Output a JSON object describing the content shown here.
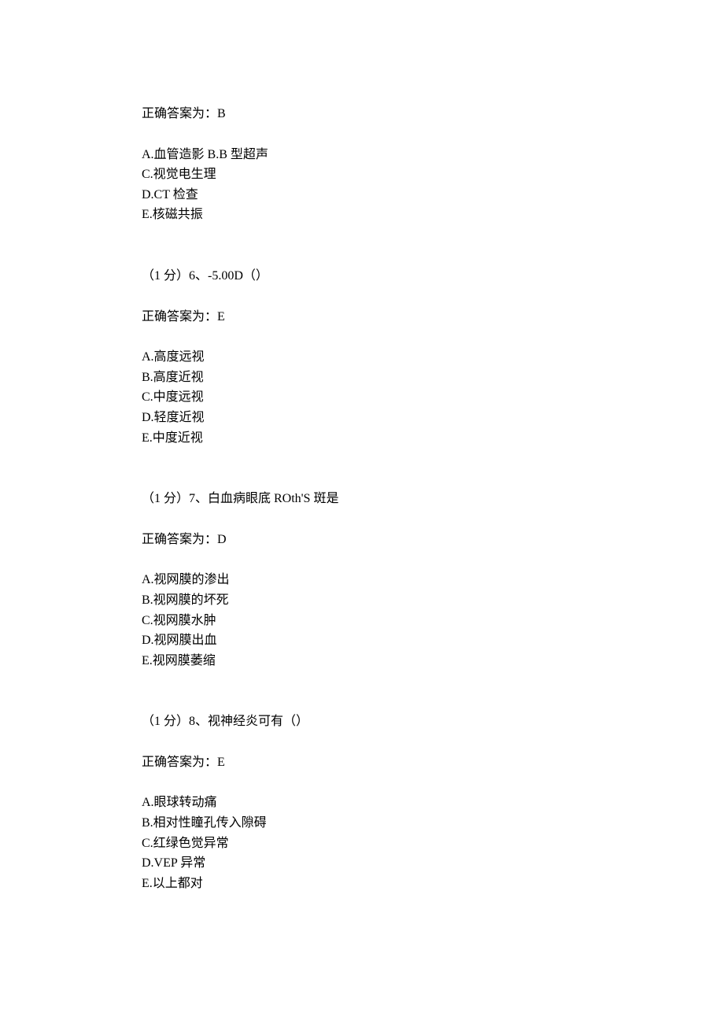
{
  "q5": {
    "answer_line": "正确答案为：B",
    "options": {
      "ab": "A.血管造影 B.B 型超声",
      "c": "C.视觉电生理",
      "d": "D.CT 检查",
      "e": "E.核磁共振"
    }
  },
  "q6": {
    "prompt": "（1 分）6、-5.00D（）",
    "answer_line": "正确答案为：E",
    "options": {
      "a": "A.高度远视",
      "b": "B.高度近视",
      "c": "C.中度远视",
      "d": "D.轻度近视",
      "e": "E.中度近视"
    }
  },
  "q7": {
    "prompt": "（1 分）7、白血病眼底 ROth'S 斑是",
    "answer_line": "正确答案为：D",
    "options": {
      "a": "A.视网膜的渗出",
      "b": "B.视网膜的坏死",
      "c": "C.视网膜水肿",
      "d": "D.视网膜出血",
      "e": "E.视网膜萎缩"
    }
  },
  "q8": {
    "prompt": "（1 分）8、视神经炎可有（）",
    "answer_line": "正确答案为：E",
    "options": {
      "a": "A.眼球转动痛",
      "b": "B.相对性瞳孔传入隙碍",
      "c": "C.红绿色觉异常",
      "d": "D.VEP 异常",
      "e": "E.以上都对"
    }
  }
}
